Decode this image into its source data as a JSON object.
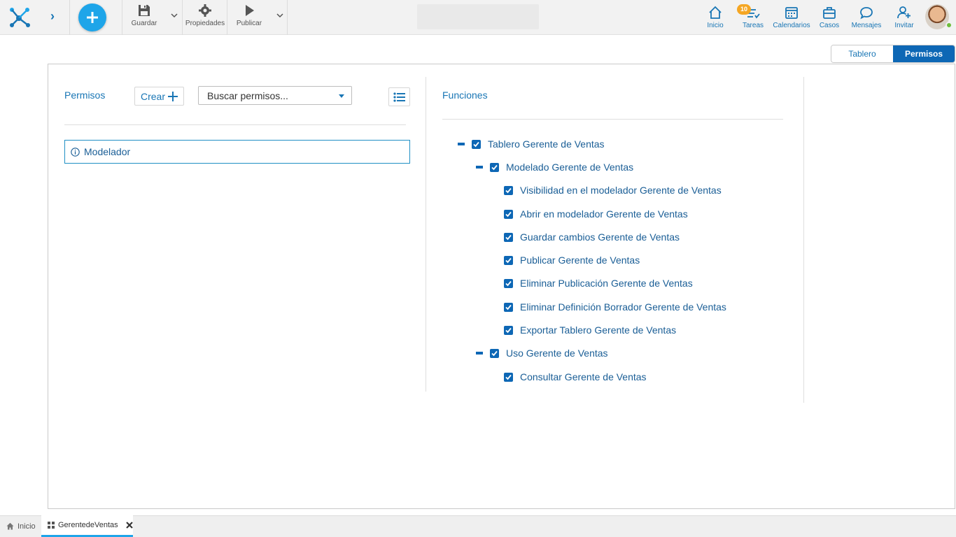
{
  "toolbar": {
    "save_label": "Guardar",
    "properties_label": "Propiedades",
    "publish_label": "Publicar"
  },
  "nav": {
    "home_label": "Inicio",
    "tasks_label": "Tareas",
    "tasks_badge": "10",
    "calendars_label": "Calendarios",
    "cases_label": "Casos",
    "messages_label": "Mensajes",
    "invite_label": "Invitar"
  },
  "view_tabs": {
    "dashboard_label": "Tablero",
    "permissions_label": "Permisos"
  },
  "permissions": {
    "title": "Permisos",
    "create_label": "Crear",
    "search_placeholder": "Buscar permisos...",
    "items": [
      "Modelador"
    ]
  },
  "functions": {
    "title": "Funciones",
    "tree": [
      {
        "label": "Tablero Gerente de Ventas",
        "level": 0,
        "checked": true,
        "collapsible": true
      },
      {
        "label": "Modelado Gerente de Ventas",
        "level": 1,
        "checked": true,
        "collapsible": true
      },
      {
        "label": "Visibilidad en el modelador Gerente de Ventas",
        "level": 2,
        "checked": true
      },
      {
        "label": "Abrir en modelador Gerente de Ventas",
        "level": 2,
        "checked": true
      },
      {
        "label": "Guardar cambios Gerente de Ventas",
        "level": 2,
        "checked": true
      },
      {
        "label": "Publicar Gerente de Ventas",
        "level": 2,
        "checked": true
      },
      {
        "label": "Eliminar Publicación Gerente de Ventas",
        "level": 2,
        "checked": true
      },
      {
        "label": "Eliminar Definición Borrador Gerente de Ventas",
        "level": 2,
        "checked": true
      },
      {
        "label": "Exportar Tablero Gerente de Ventas",
        "level": 2,
        "checked": true
      },
      {
        "label": "Uso Gerente de Ventas",
        "level": 1,
        "checked": true,
        "collapsible": true
      },
      {
        "label": "Consultar Gerente de Ventas",
        "level": 2,
        "checked": true
      }
    ]
  },
  "bottom_tabs": {
    "home_label": "Inicio",
    "current_label": "GerentedeVentas"
  },
  "colors": {
    "accent": "#0d67b5",
    "brand_light": "#1ea5e9",
    "badge": "#f5a623"
  }
}
